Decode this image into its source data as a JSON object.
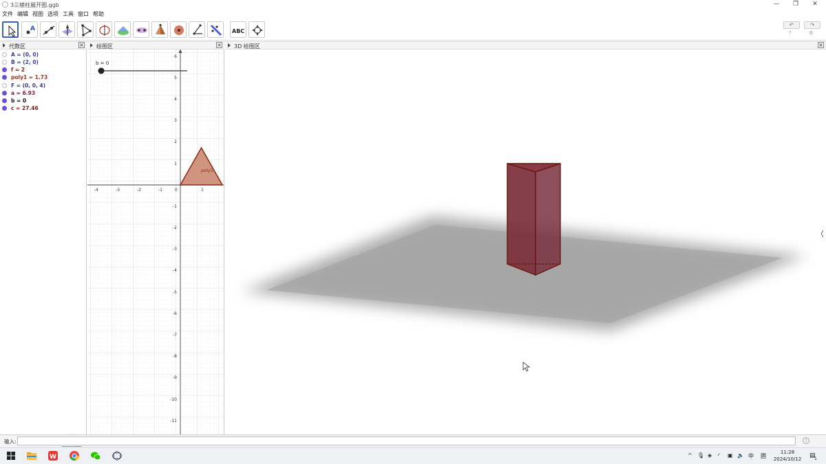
{
  "window": {
    "title": "3三棱柱展开图.ggb",
    "minimize": "—",
    "restore": "❐",
    "close": "✕"
  },
  "menu": [
    "文件",
    "编辑",
    "视图",
    "选项",
    "工具",
    "窗口",
    "帮助"
  ],
  "toolbar": {
    "tools": [
      {
        "name": "move-tool-button",
        "icon": "arrow-icon"
      },
      {
        "name": "point-tool-button",
        "icon": "point-icon"
      },
      {
        "name": "line-tool-button",
        "icon": "line-icon"
      },
      {
        "name": "perpendicular-tool-button",
        "icon": "perpendicular-icon"
      },
      {
        "name": "polygon-tool-button",
        "icon": "polygon-icon"
      },
      {
        "name": "circle-tool-button",
        "icon": "circle-icon"
      },
      {
        "name": "plane-tool-button",
        "icon": "plane-icon"
      },
      {
        "name": "intersect-tool-button",
        "icon": "intersect-icon"
      },
      {
        "name": "pyramid-tool-button",
        "icon": "pyramid-icon"
      },
      {
        "name": "sphere-tool-button",
        "icon": "sphere-icon"
      },
      {
        "name": "angle-tool-button",
        "icon": "angle-icon"
      },
      {
        "name": "reflect-tool-button",
        "icon": "reflect-icon"
      },
      {
        "name": "text-tool-button",
        "icon": "text-icon",
        "label": "ABC"
      },
      {
        "name": "rotate-view-tool-button",
        "icon": "rotate-view-icon"
      }
    ],
    "undo_icon": "undo-icon",
    "redo_icon": "redo-icon"
  },
  "views": {
    "algebra": {
      "title": "代数区"
    },
    "graphics": {
      "title": "绘图区"
    },
    "graphics3d": {
      "title": "3D 绘图区"
    }
  },
  "algebra_items": [
    {
      "label": "A = (0, 0)",
      "color": "#3d3d8f",
      "dot": "hollow"
    },
    {
      "label": "B = (2, 0)",
      "color": "#3d3d8f",
      "dot": "hollow"
    },
    {
      "label": "f = 2",
      "color": "#7a1f1f",
      "dot": "#6b4fd8"
    },
    {
      "label": "poly1 = 1.73",
      "color": "#a0301f",
      "dot": "#6b4fd8"
    },
    {
      "label": "F = (0, 0, 4)",
      "color": "#3d3d8f",
      "dot": "hollow"
    },
    {
      "label": "a = 6.93",
      "color": "#8b1a3a",
      "dot": "#6b4fd8"
    },
    {
      "label": "b = 0",
      "color": "#111111",
      "dot": "#6b4fd8"
    },
    {
      "label": "c = 27.46",
      "color": "#7a1f1f",
      "dot": "#6b4fd8"
    }
  ],
  "graphics_view": {
    "slider_label": "b = 0",
    "polygon_label": "poly1",
    "x_ticks": [
      "-4",
      "-3",
      "-2",
      "-1",
      "0",
      "1"
    ],
    "y_ticks": [
      "6",
      "5",
      "4",
      "3",
      "2",
      "1",
      "-1",
      "-2",
      "-3",
      "-4",
      "-5",
      "-6",
      "-7",
      "-8",
      "-9",
      "-10",
      "-11"
    ],
    "polygon_color": "#c8826a",
    "polygon_stroke": "#8b2a10"
  },
  "graphics3d_view": {
    "prism_color": "#7a2f3a",
    "prism_edge": "#6b1a12",
    "plane_color": "#a0a0a0"
  },
  "input_bar": {
    "label": "输入:",
    "value": "",
    "help_icon": "help-icon"
  },
  "taskbar": {
    "apps": [
      "windows-start-icon",
      "file-explorer-icon",
      "wps-icon",
      "chrome-icon",
      "wechat-icon",
      "geogebra-icon"
    ],
    "tray_ime": "中",
    "tray_grid": "囲",
    "time": "11:28",
    "date": "2024/10/12",
    "notification_count": "1"
  }
}
